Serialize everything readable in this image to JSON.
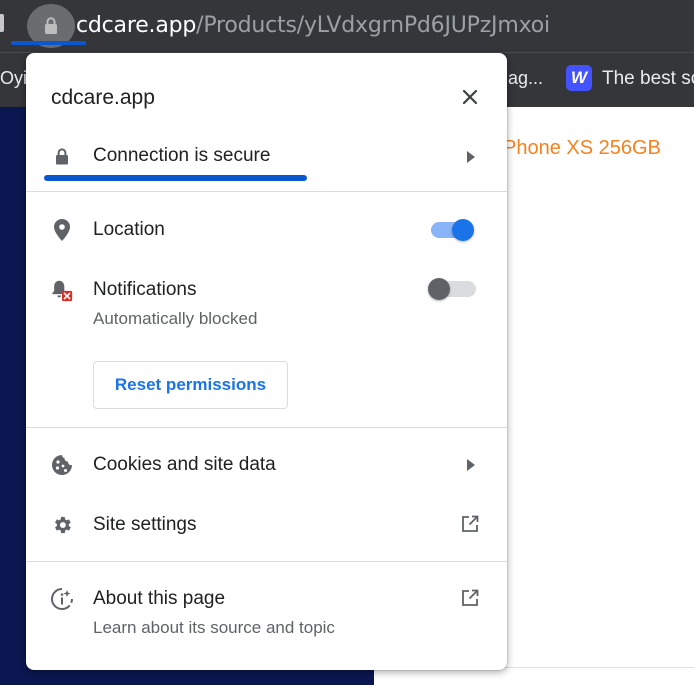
{
  "browser": {
    "url_host": "cdcare.app",
    "url_path": "/Products/yLVdxgrnPd6JUPzJmxoi",
    "bookmarks": [
      {
        "label": "Oyi"
      },
      {
        "label": "ag..."
      },
      {
        "label": "The best scr",
        "icon": "webflow-icon",
        "icon_letter": "W"
      }
    ]
  },
  "page": {
    "product_title": "Phone XS 256GB"
  },
  "popup": {
    "site_name": "cdcare.app",
    "connection_label": "Connection is secure",
    "permissions": [
      {
        "label": "Location",
        "icon": "location-pin-icon",
        "toggle_on": true
      },
      {
        "label": "Notifications",
        "sublabel": "Automatically blocked",
        "icon": "notifications-blocked-icon",
        "toggle_on": false
      }
    ],
    "reset_button": "Reset permissions",
    "cookies_label": "Cookies and site data",
    "site_settings_label": "Site settings",
    "about_label": "About this page",
    "about_sublabel": "Learn about its source and topic"
  },
  "colors": {
    "accent_blue": "#1a73e8",
    "annotation_blue": "#0b57d0",
    "product_orange": "#f58220",
    "chrome_dark": "#35363a",
    "page_navy": "#0b1750"
  }
}
